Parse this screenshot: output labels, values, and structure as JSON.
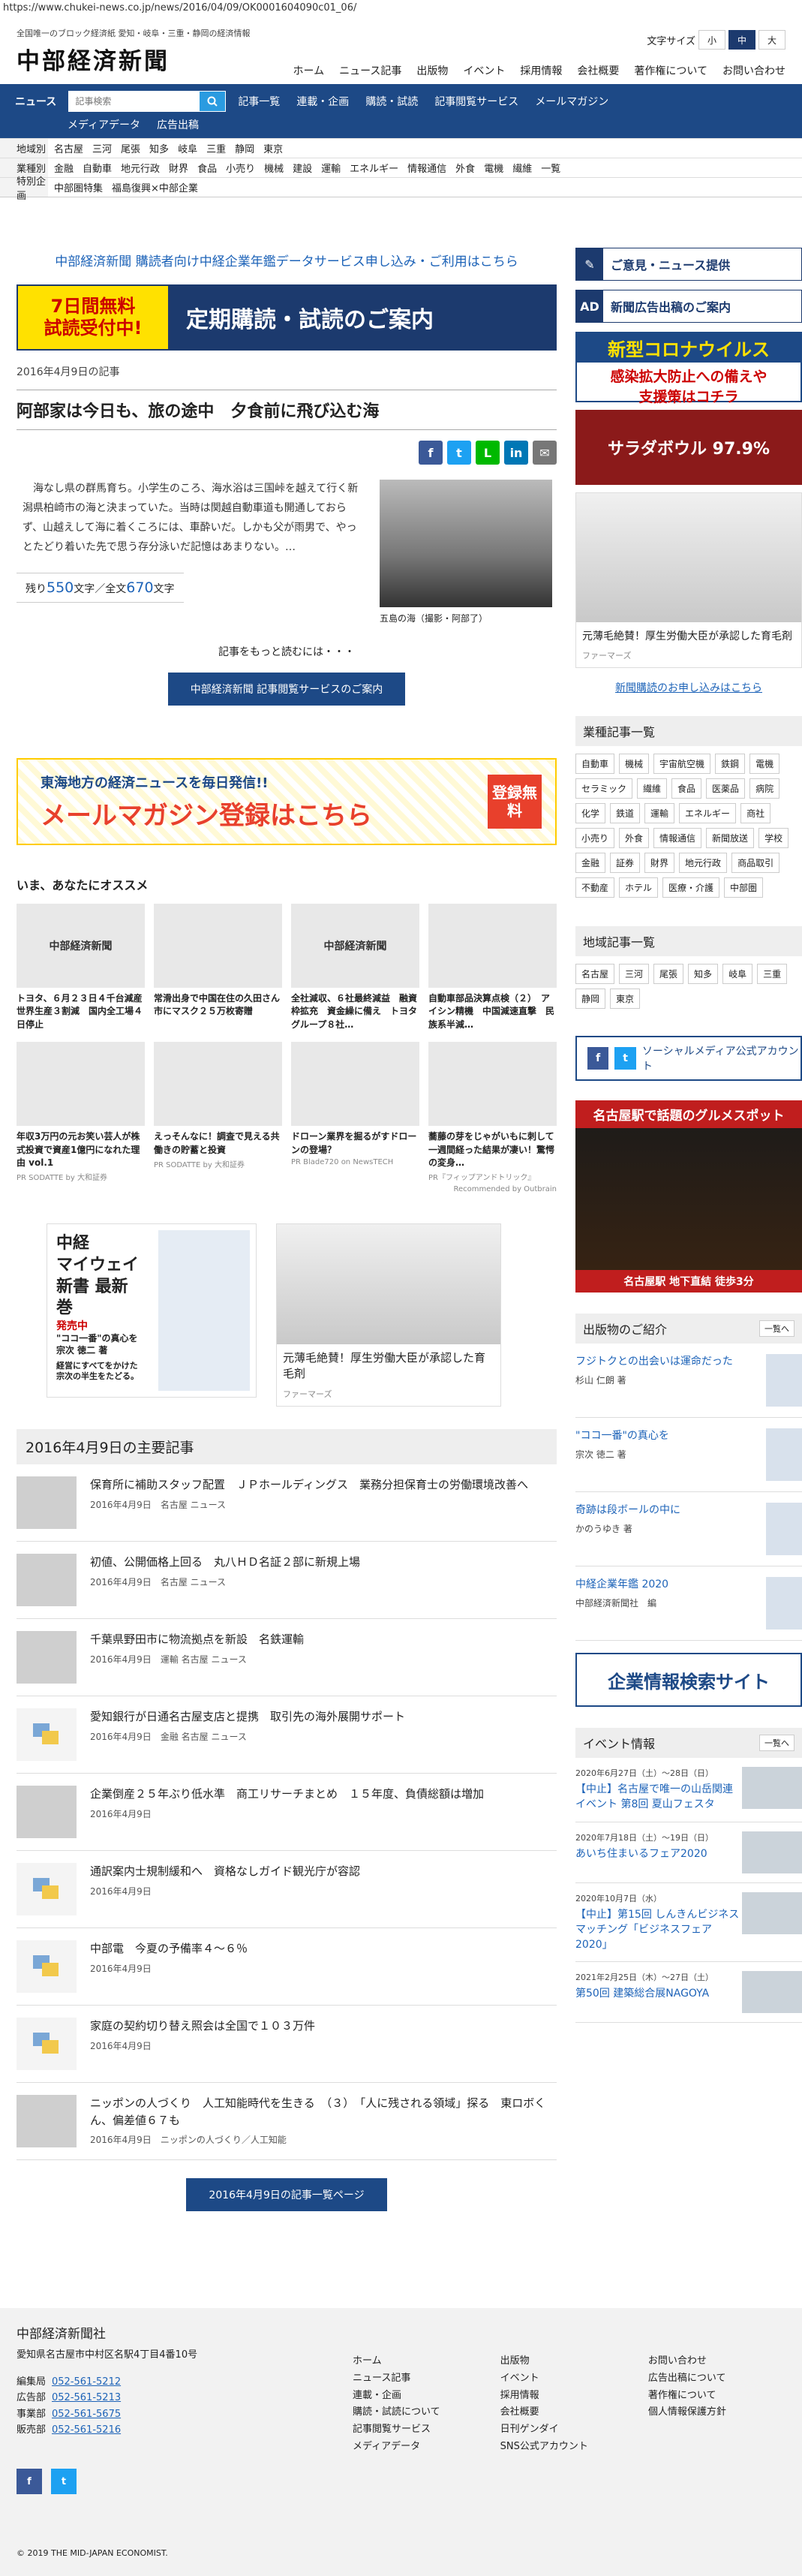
{
  "url": "https://www.chukei-news.co.jp/news/2016/04/09/OK0001604090c01_06/",
  "header": {
    "tagline": "全国唯一のブロック経済紙 愛知・岐阜・三重・静岡の経済情報",
    "logo": "中部経済新聞",
    "fontsize_label": "文字サイズ",
    "fontsize": [
      "小",
      "中",
      "大"
    ],
    "topnav": [
      "ホーム",
      "ニュース記事",
      "出版物",
      "イベント",
      "採用情報",
      "会社概要",
      "著作権について",
      "お問い合わせ"
    ]
  },
  "nav": {
    "news": "ニュース",
    "search_placeholder": "記事検索",
    "items": [
      "記事一覧",
      "連載・企画",
      "購読・試読",
      "記事閲覧サービス",
      "メールマガジン"
    ],
    "row2": [
      "メディアデータ",
      "広告出稿"
    ]
  },
  "subnav": [
    {
      "label": "地域別",
      "items": [
        "名古屋",
        "三河",
        "尾張",
        "知多",
        "岐阜",
        "三重",
        "静岡",
        "東京"
      ]
    },
    {
      "label": "業種別",
      "items": [
        "金融",
        "自動車",
        "地元行政",
        "財界",
        "食品",
        "小売り",
        "機械",
        "建設",
        "運輸",
        "エネルギー",
        "情報通信",
        "外食",
        "電機",
        "繊維",
        "一覧"
      ]
    },
    {
      "label": "特別企画",
      "items": [
        "中部圏特集",
        "福島復興×中部企業"
      ]
    }
  ],
  "main": {
    "promo_link": "中部経済新聞 購読者向け中経企業年鑑データサービス申し込み・ご利用はこちら",
    "trial_left": [
      "7日間無料",
      "試読受付中!"
    ],
    "trial_right": "定期購読・試読のご案内",
    "date": "2016年4月9日の記事",
    "title": "阿部家は今日も、旅の途中　夕食前に飛び込む海",
    "lead": "　海なし県の群馬育ち。小学生のころ、海水浴は三国峠を越えて行く新潟県柏崎市の海と決まっていた。当時は関越自動車道も開通しておらず、山越えして海に着くころには、車酔いだ。しかも父が雨男で、やっとたどり着いた先で思う存分泳いだ記憶はあまりない。…",
    "count_pre": "残り",
    "count_rest": "550",
    "count_mid": "文字／全文",
    "count_total": "670",
    "count_post": "文字",
    "photo_caption": "五島の海（撮影・阿部了）",
    "more": "記事をもっと読むには・・・",
    "more_btn": "中部経済新聞 記事閲覧サービスのご案内",
    "mailmag_1": "東海地方の経済ニュースを毎日発信!!",
    "mailmag_2": "メールマガジン登録はこちら",
    "mailmag_free": "登録無料",
    "recommend_title": "いま、あなたにオススメ",
    "rec": [
      {
        "img": "中部経済新聞",
        "t": "トヨタ、６月２３日４千台減産　世界生産３割減　国内全工場４日停止",
        "s": ""
      },
      {
        "img": "",
        "t": "常滑出身で中国在住の久田さん　市にマスク２５万枚寄贈",
        "s": ""
      },
      {
        "img": "中部経済新聞",
        "t": "全社減収、６社最終減益　融資枠拡充　資金繰に備え　トヨタグループ８社…",
        "s": ""
      },
      {
        "img": "",
        "t": "自動車部品決算点検（２）　アイシン精機　中国減速直撃　民族系半減…",
        "s": ""
      },
      {
        "img": "",
        "t": "年収3万円の元お笑い芸人が株式投資で資産1億円になれた理由 vol.1",
        "s": "PR SODATTE by 大和証券"
      },
      {
        "img": "",
        "t": "えっそんなに！調査で見える共働きの貯蓄と投資",
        "s": "PR SODATTE by 大和証券"
      },
      {
        "img": "",
        "t": "ドローン業界を掘るがすドローンの登場？",
        "s": "PR Blade720 on NewsTECH"
      },
      {
        "img": "",
        "t": "蕎藤の芽をじゃがいもに刺して一週間経った結果が凄い！驚愕の変身…",
        "s": "PR『フィップアンドトリック』"
      }
    ],
    "outbrain": "Recommended by Outbrain",
    "book_ad": [
      "中経",
      "マイウェイ",
      "新書 最新巻",
      "発売中",
      "\"ココ一番\"の真心を",
      "宗次 徳二 著",
      "経営にすべてをかけた",
      "宗次の半生をたどる。"
    ],
    "hair_ad_t": "元薄毛絶賛！厚生労働大臣が承認した育毛剤",
    "hair_ad_s": "ファーマーズ",
    "list_title": "2016年4月9日の主要記事",
    "articles": [
      {
        "t": "保育所に補助スタッフ配置　ＪＰホールディングス　業務分担保育士の労働環境改善へ",
        "d": "2016年4月9日",
        "c": "名古屋 ニュース",
        "ic": false
      },
      {
        "t": "初値、公開価格上回る　丸八ＨＤ名証２部に新規上場",
        "d": "2016年4月9日",
        "c": "名古屋 ニュース",
        "ic": false
      },
      {
        "t": "千葉県野田市に物流拠点を新設　名鉄運輸",
        "d": "2016年4月9日",
        "c": "運輸 名古屋 ニュース",
        "ic": false
      },
      {
        "t": "愛知銀行が日通名古屋支店と提携　取引先の海外展開サポート",
        "d": "2016年4月9日",
        "c": "金融 名古屋 ニュース",
        "ic": true
      },
      {
        "t": "企業倒産２５年ぶり低水準　商工リサーチまとめ　１５年度、負債総額は増加",
        "d": "2016年4月9日",
        "c": "",
        "ic": false
      },
      {
        "t": "通訳案内士規制緩和へ　資格なしガイド観光庁が容認",
        "d": "2016年4月9日",
        "c": "",
        "ic": true
      },
      {
        "t": "中部電　今夏の予備率４～６％",
        "d": "2016年4月9日",
        "c": "",
        "ic": true
      },
      {
        "t": "家庭の契約切り替え照会は全国で１０３万件",
        "d": "2016年4月9日",
        "c": "",
        "ic": true
      },
      {
        "t": "ニッポンの人づくり　人工知能時代を生きる　（３）　「人に残される領域」探る　東ロボくん、偏差値６７も",
        "d": "2016年4月9日",
        "c": "ニッポンの人づくり／人工知能",
        "ic": false
      }
    ],
    "list_btn": "2016年4月9日の記事一覧ページ"
  },
  "side": {
    "btn1": "ご意見・ニュース提供",
    "btn2": "新聞広告出稿のご案内",
    "corona": [
      "新型コロナウイルス",
      "感染拡大防止への備えや",
      "支援策はコチラ"
    ],
    "salad": "サラダボウル 97.9%",
    "hair_t": "元薄毛絶賛！厚生労働大臣が承認した育毛剤",
    "hair_s": "ファーマーズ",
    "blue_link": "新聞購読のお申し込みはこちら",
    "gyoshu_h": "業種記事一覧",
    "gyoshu": [
      "自動車",
      "機械",
      "宇宙航空機",
      "鉄鋼",
      "電機",
      "セラミック",
      "繊維",
      "食品",
      "医薬品",
      "病院",
      "化学",
      "鉄道",
      "運輸",
      "エネルギー",
      "商社",
      "小売り",
      "外食",
      "情報通信",
      "新聞放送",
      "学校",
      "金融",
      "証券",
      "財界",
      "地元行政",
      "商品取引",
      "不動産",
      "ホテル",
      "医療・介護",
      "中部圏"
    ],
    "chiiki_h": "地域記事一覧",
    "chiiki": [
      "名古屋",
      "三河",
      "尾張",
      "知多",
      "岐阜",
      "三重",
      "静岡",
      "東京"
    ],
    "social": "ソーシャルメディア公式アカウント",
    "gourmet_1": "名古屋駅で話題のグルメスポット",
    "gourmet_2": "名古屋駅 地下直結 徒歩3分",
    "pubs_h": "出版物のご紹介",
    "ichiran": "一覧へ",
    "pubs": [
      {
        "t": "フジトクとの出会いは運命だった",
        "a": "杉山 仁朗 著"
      },
      {
        "t": "\"ココ一番\"の真心を",
        "a": "宗次 徳二 著"
      },
      {
        "t": "奇跡は段ボールの中に",
        "a": "かのうゆき 著"
      },
      {
        "t": "中経企業年鑑 2020",
        "a": "中部経済新聞社　編"
      }
    ],
    "kigyou": "企業情報検索サイト",
    "events_h": "イベント情報",
    "events": [
      {
        "d": "2020年6月27日（土）～28日（日）",
        "t": "【中止】名古屋で唯一の山岳関連イベント 第8回 夏山フェスタ"
      },
      {
        "d": "2020年7月18日（土）～19日（日）",
        "t": "あいち住まいるフェア2020"
      },
      {
        "d": "2020年10月7日（水）",
        "t": "【中止】第15回 しんきんビジネスマッチング「ビジネスフェア2020」"
      },
      {
        "d": "2021年2月25日（木）～27日（土）",
        "t": "第50回 建築総合展NAGOYA"
      }
    ]
  },
  "footer": {
    "name": "中部経済新聞社",
    "addr": "愛知県名古屋市中村区名駅4丁目4番10号",
    "tels": [
      {
        "l": "編集局",
        "n": "052-561-5212"
      },
      {
        "l": "広告部",
        "n": "052-561-5213"
      },
      {
        "l": "事業部",
        "n": "052-561-5675"
      },
      {
        "l": "販売部",
        "n": "052-561-5216"
      }
    ],
    "col1": [
      "ホーム",
      "ニュース記事",
      "連載・企画",
      "購読・試読について",
      "記事閲覧サービス",
      "メディアデータ"
    ],
    "col2": [
      "出版物",
      "イベント",
      "採用情報",
      "会社概要",
      "日刊ゲンダイ",
      "SNS公式アカウント"
    ],
    "col3": [
      "お問い合わせ",
      "広告出稿について",
      "著作権について",
      "個人情報保護方針"
    ],
    "copy": "© 2019 THE MID-JAPAN ECONOMIST."
  }
}
